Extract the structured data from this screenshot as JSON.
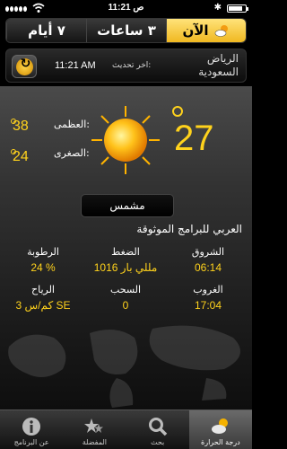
{
  "status": {
    "time": "11:21 ص"
  },
  "tabs": [
    {
      "label": "٧ أيام"
    },
    {
      "label": "٣ ساعات"
    },
    {
      "label": "الآن"
    }
  ],
  "location": {
    "city_line1": "الرياض",
    "city_line2": "السعودية",
    "update_label": "اخر تحديث:",
    "update_time": "11:21 AM"
  },
  "current": {
    "temperature": "27",
    "high_label": "العظمى:",
    "high_value": "38",
    "low_label": "الصغرى:",
    "low_value": "24",
    "condition": "مشمس",
    "provider": "العربي للبرامج الموثوقة"
  },
  "details": {
    "sunrise_label": "الشروق",
    "sunrise_value": "06:14",
    "pressure_label": "الضغط",
    "pressure_value": "1016 مللي بار",
    "humidity_label": "الرطوبة",
    "humidity_value": "24 %",
    "sunset_label": "الغروب",
    "sunset_value": "17:04",
    "clouds_label": "السحب",
    "clouds_value": "0",
    "wind_label": "الرياح",
    "wind_value": "3 كم/س SE"
  },
  "bottom_tabs": [
    {
      "label": "عن البرنامج",
      "icon": "info-icon"
    },
    {
      "label": "المفضلة",
      "icon": "stars-icon"
    },
    {
      "label": "بحث",
      "icon": "search-icon"
    },
    {
      "label": "درجة الحرارة",
      "icon": "weather-icon"
    }
  ]
}
